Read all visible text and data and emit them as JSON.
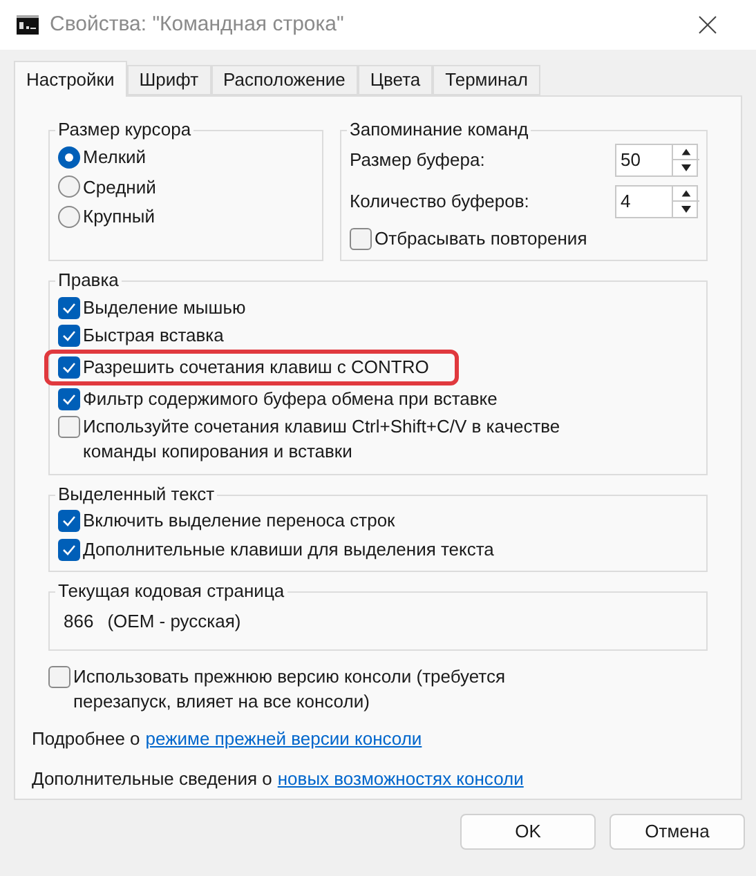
{
  "window": {
    "title": "Свойства: \"Командная строка\""
  },
  "tabs": [
    {
      "label": "Настройки",
      "selected": true
    },
    {
      "label": "Шрифт",
      "selected": false
    },
    {
      "label": "Расположение",
      "selected": false
    },
    {
      "label": "Цвета",
      "selected": false
    },
    {
      "label": "Терминал",
      "selected": false
    }
  ],
  "cursor_size": {
    "title": "Размер курсора",
    "options": [
      {
        "label": "Мелкий",
        "selected": true
      },
      {
        "label": "Средний",
        "selected": false
      },
      {
        "label": "Крупный",
        "selected": false
      }
    ]
  },
  "command_history": {
    "title": "Запоминание команд",
    "fields": [
      {
        "label": "Размер буфера:",
        "value": "50"
      },
      {
        "label": "Количество буферов:",
        "value": "4"
      }
    ],
    "discard_duplicates": {
      "label": "Отбрасывать повторения",
      "checked": false
    }
  },
  "edit_options": {
    "title": "Правка",
    "items": [
      {
        "label": "Выделение мышью",
        "checked": true,
        "highlighted": false
      },
      {
        "label": "Быстрая вставка",
        "checked": true,
        "highlighted": false
      },
      {
        "label": "Разрешить сочетания клавиш с CONTRO",
        "checked": true,
        "highlighted": true
      },
      {
        "label": "Фильтр содержимого буфера обмена при вставке",
        "checked": true,
        "highlighted": false
      },
      {
        "label": "Используйте сочетания клавиш Ctrl+Shift+C/V в качестве команды копирования и вставки",
        "checked": false,
        "highlighted": false
      }
    ]
  },
  "text_selection": {
    "title": "Выделенный текст",
    "items": [
      {
        "label": "Включить выделение переноса строк",
        "checked": true
      },
      {
        "label": "Дополнительные клавиши для выделения текста",
        "checked": true
      }
    ]
  },
  "code_page": {
    "title": "Текущая кодовая страница",
    "number": "866",
    "name": "(OEM - русская)"
  },
  "legacy_console": {
    "label": "Использовать прежнюю версию консоли (требуется перезапуск, влияет на все консоли)",
    "checked": false
  },
  "links": [
    {
      "prefix": "Подробнее о",
      "link": "режиме прежней версии консоли"
    },
    {
      "prefix": "Дополнительные сведения о",
      "link": "новых возможностях консоли"
    }
  ],
  "buttons": [
    "OK",
    "Отмена"
  ]
}
